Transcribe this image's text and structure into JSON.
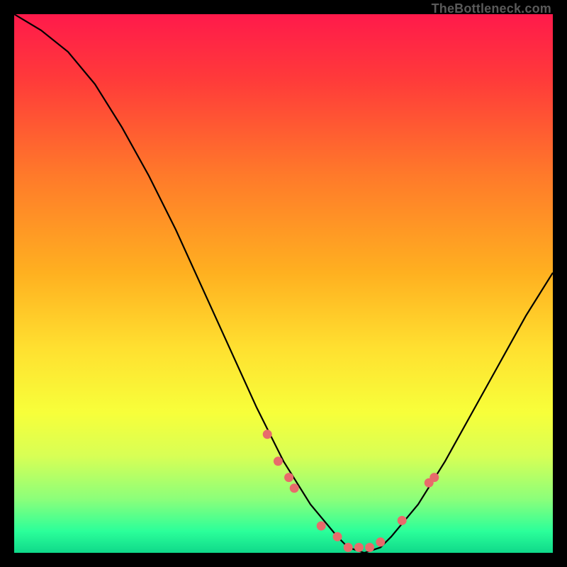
{
  "attribution": "TheBottleneck.com",
  "chart_data": {
    "type": "line",
    "title": "",
    "xlabel": "",
    "ylabel": "",
    "xlim": [
      0,
      100
    ],
    "ylim": [
      0,
      100
    ],
    "curve": {
      "name": "bottleneck-curve",
      "x": [
        0,
        5,
        10,
        15,
        20,
        25,
        30,
        35,
        40,
        45,
        50,
        55,
        60,
        62,
        65,
        68,
        70,
        75,
        80,
        85,
        90,
        95,
        100
      ],
      "y": [
        100,
        97,
        93,
        87,
        79,
        70,
        60,
        49,
        38,
        27,
        17,
        9,
        3,
        1,
        0,
        1,
        3,
        9,
        17,
        26,
        35,
        44,
        52
      ]
    },
    "markers": {
      "name": "sample-points",
      "color": "#e86b6b",
      "x": [
        47,
        49,
        51,
        52,
        57,
        60,
        62,
        64,
        66,
        68,
        72,
        77,
        78
      ],
      "y": [
        22,
        17,
        14,
        12,
        5,
        3,
        1,
        1,
        1,
        2,
        6,
        13,
        14
      ]
    },
    "gradient_stops": [
      {
        "offset": 0.0,
        "color": "#ff1a4b"
      },
      {
        "offset": 0.12,
        "color": "#ff3a3a"
      },
      {
        "offset": 0.3,
        "color": "#ff7a2a"
      },
      {
        "offset": 0.48,
        "color": "#ffb020"
      },
      {
        "offset": 0.62,
        "color": "#ffe030"
      },
      {
        "offset": 0.74,
        "color": "#f7ff3a"
      },
      {
        "offset": 0.82,
        "color": "#d8ff55"
      },
      {
        "offset": 0.9,
        "color": "#8cff7a"
      },
      {
        "offset": 0.96,
        "color": "#2bff9a"
      },
      {
        "offset": 1.0,
        "color": "#0fd98a"
      }
    ]
  }
}
